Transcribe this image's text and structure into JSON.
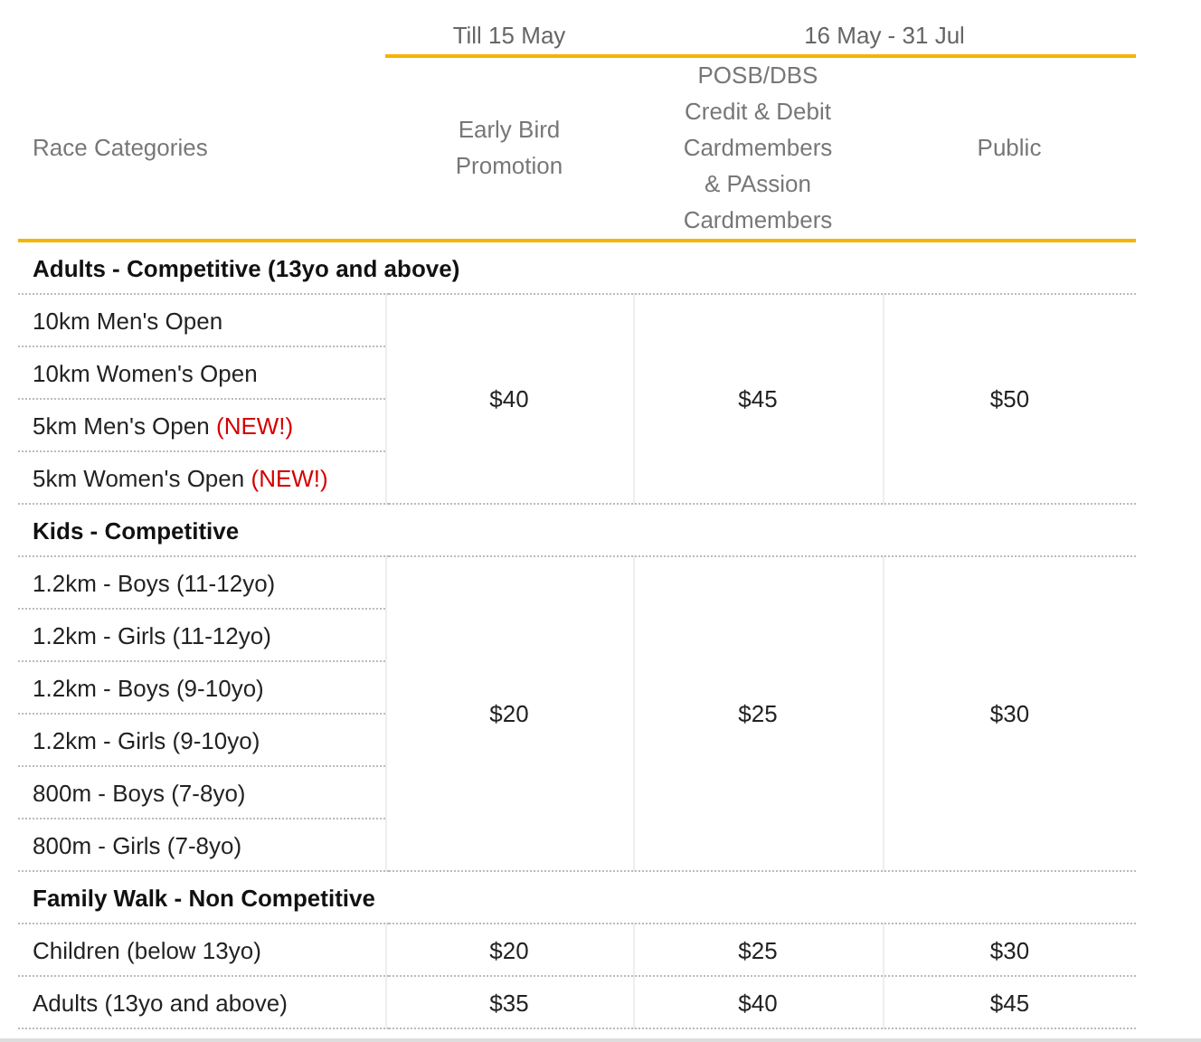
{
  "period_headers": [
    {
      "label": "Till 15 May"
    },
    {
      "label": "16 May - 31 Jul"
    }
  ],
  "column_headers": {
    "category": "Race Categories",
    "tiers": [
      "Early Bird Promotion",
      "POSB/DBS Credit & Debit Cardmembers & PAssion Cardmembers",
      "Public"
    ]
  },
  "groups": [
    {
      "title": "Adults - Competitive (13yo and above)",
      "kind": "shared",
      "prices": [
        "$40",
        "$45",
        "$50"
      ],
      "rows": [
        {
          "name": "10km Men's Open"
        },
        {
          "name": "10km Women's Open"
        },
        {
          "name": "5km Men's Open",
          "tag": "(NEW!)"
        },
        {
          "name": "5km Women's Open",
          "tag": "(NEW!)"
        }
      ]
    },
    {
      "title": "Kids - Competitive",
      "kind": "shared",
      "prices": [
        "$20",
        "$25",
        "$30"
      ],
      "rows": [
        {
          "name": "1.2km - Boys (11-12yo)"
        },
        {
          "name": "1.2km - Girls (11-12yo)"
        },
        {
          "name": "1.2km - Boys (9-10yo)"
        },
        {
          "name": "1.2km - Girls (9-10yo)"
        },
        {
          "name": "800m - Boys (7-8yo)"
        },
        {
          "name": "800m - Girls (7-8yo)"
        }
      ]
    },
    {
      "title": "Family Walk - Non Competitive",
      "kind": "per_row",
      "rows": [
        {
          "name": "Children (below 13yo)",
          "prices": [
            "$20",
            "$25",
            "$30"
          ]
        },
        {
          "name": "Adults (13yo and above)",
          "prices": [
            "$35",
            "$40",
            "$45"
          ]
        }
      ]
    }
  ]
}
